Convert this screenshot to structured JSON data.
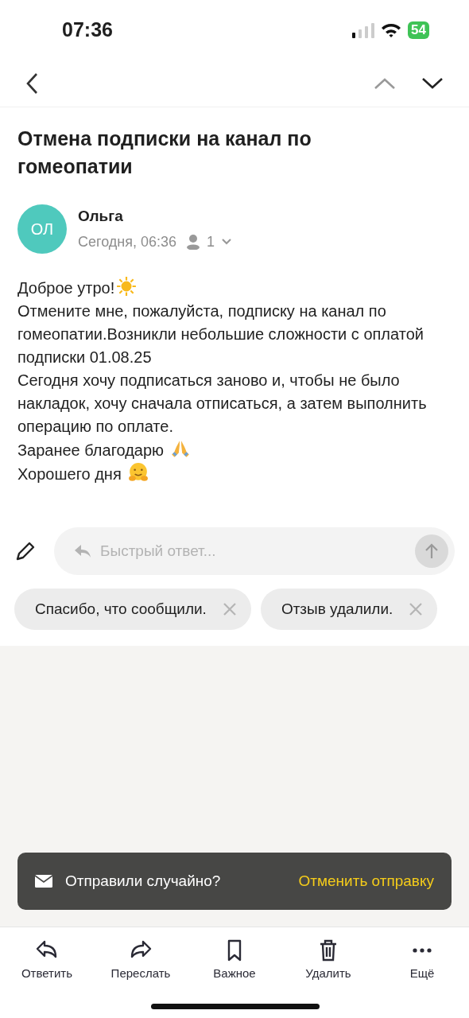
{
  "status_bar": {
    "time": "07:36",
    "battery": "54"
  },
  "nav": {
    "up_disabled": true,
    "down_disabled": false
  },
  "subject": "Отмена подписки на канал по гомеопатии",
  "sender": {
    "initials": "ОЛ",
    "color": "#4fc9bd",
    "name": "Ольга",
    "date": "Сегодня, 06:36",
    "recipients": "1"
  },
  "body": [
    {
      "text": "Доброе утро!",
      "kind": "sun"
    },
    {
      "text": "Отмените мне, пожалуйста,  подписку на канал по гомеопатии.Возникли небольшие сложности с оплатой подписки 01.08.25"
    },
    {
      "text": "Сегодня хочу подписаться заново и, чтобы не было накладок, хочу сначала отписаться, а затем выполнить операцию по оплате."
    },
    {
      "text": "Заранее благодарю",
      "kind": "pray"
    },
    {
      "text": "Хорошего дня",
      "kind": "hug"
    }
  ],
  "quick_reply": {
    "placeholder": "Быстрый ответ..."
  },
  "suggestions": [
    "Спасибо, что сообщили.",
    "Отзыв удалили."
  ],
  "toast": {
    "message": "Отправили случайно?",
    "action": "Отменить отправку"
  },
  "toolbar": [
    {
      "kind": "reply",
      "label": "Ответить"
    },
    {
      "kind": "forward",
      "label": "Переслать"
    },
    {
      "kind": "bookmark",
      "label": "Важное"
    },
    {
      "kind": "trash",
      "label": "Удалить"
    },
    {
      "kind": "more",
      "label": "Ещё"
    }
  ]
}
